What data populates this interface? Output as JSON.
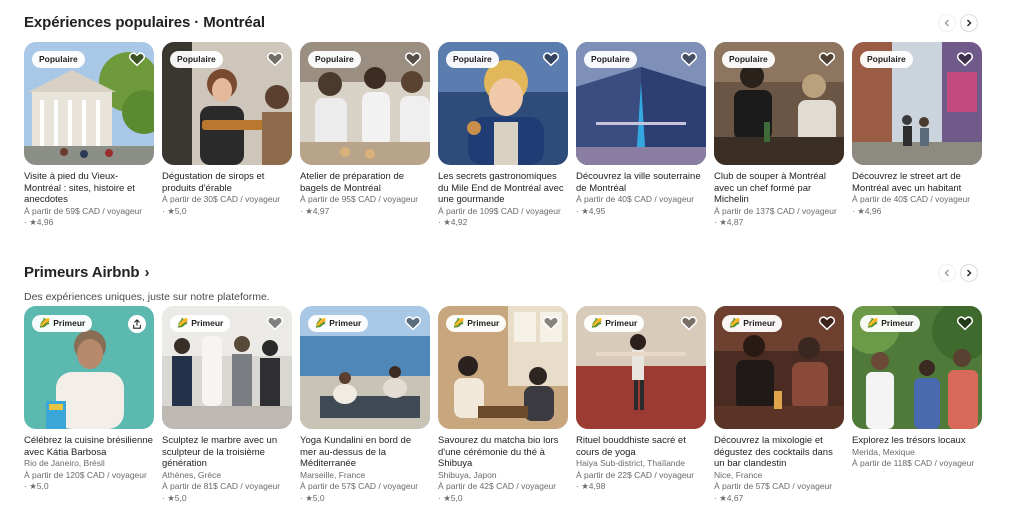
{
  "popular": {
    "title": "Expériences populaires · Montréal",
    "cards": [
      {
        "badge": "Populaire",
        "title": "Visite à pied du Vieux-Montréal : sites, histoire et anecdotes",
        "price": "À partir de 59$ CAD / voyageur",
        "rating": "· ★4,96"
      },
      {
        "badge": "Populaire",
        "title": "Dégustation de sirops et produits d'érable",
        "price": "À partir de 30$ CAD / voyageur",
        "rating": "· ★5,0"
      },
      {
        "badge": "Populaire",
        "title": "Atelier de préparation de bagels de Montréal",
        "price": "À partir de 95$ CAD / voyageur",
        "rating": "· ★4,97"
      },
      {
        "badge": "Populaire",
        "title": "Les secrets gastronomiques du Mile End de Montréal avec une gourmande",
        "price": "À partir de 109$ CAD / voyageur",
        "rating": "· ★4,92"
      },
      {
        "badge": "Populaire",
        "title": "Découvrez la ville souterraine de Montréal",
        "price": "À partir de 40$ CAD / voyageur",
        "rating": "· ★4,95"
      },
      {
        "badge": "Populaire",
        "title": "Club de souper à Montréal avec un chef formé par Michelin",
        "price": "À partir de 137$ CAD / voyageur",
        "rating": "· ★4,87"
      },
      {
        "badge": "Populaire",
        "title": "Découvrez le street art de Montréal avec un habitant",
        "price": "À partir de 40$ CAD / voyageur",
        "rating": "· ★4,96"
      }
    ]
  },
  "primeurs": {
    "title": "Primeurs Airbnb",
    "subtitle": "Des expériences uniques, juste sur notre plateforme.",
    "cards": [
      {
        "badge": "Primeur",
        "title": "Célébrez la cuisine brésilienne avec Kátia Barbosa",
        "location": "Rio de Janeiro, Brésil",
        "price": "À partir de 120$ CAD / voyageur",
        "rating": "· ★5,0"
      },
      {
        "badge": "Primeur",
        "title": "Sculptez le marbre avec un sculpteur de la troisième génération",
        "location": "Athènes, Grèce",
        "price": "À partir de 81$ CAD / voyageur",
        "rating": "· ★5,0"
      },
      {
        "badge": "Primeur",
        "title": "Yoga Kundalini en bord de mer au-dessus de la Méditerranée",
        "location": "Marseille, France",
        "price": "À partir de 57$ CAD / voyageur",
        "rating": "· ★5,0"
      },
      {
        "badge": "Primeur",
        "title": "Savourez du matcha bio lors d'une cérémonie du thé à Shibuya",
        "location": "Shibuya, Japon",
        "price": "À partir de 42$ CAD / voyageur",
        "rating": "· ★5,0"
      },
      {
        "badge": "Primeur",
        "title": "Rituel bouddhiste sacré et cours de yoga",
        "location": "Haiya Sub-district, Thaïlande",
        "price": "À partir de 22$ CAD / voyageur",
        "rating": "· ★4,98"
      },
      {
        "badge": "Primeur",
        "title": "Découvrez la mixologie et dégustez des cocktails dans un bar clandestin",
        "location": "Nice, France",
        "price": "À partir de 57$ CAD / voyageur",
        "rating": "· ★4,67"
      },
      {
        "badge": "Primeur",
        "title": "Explorez les trésors locaux",
        "location": "Merida, Mexique",
        "price": "À partir de 118$ CAD / voyageur",
        "rating": ""
      }
    ]
  }
}
